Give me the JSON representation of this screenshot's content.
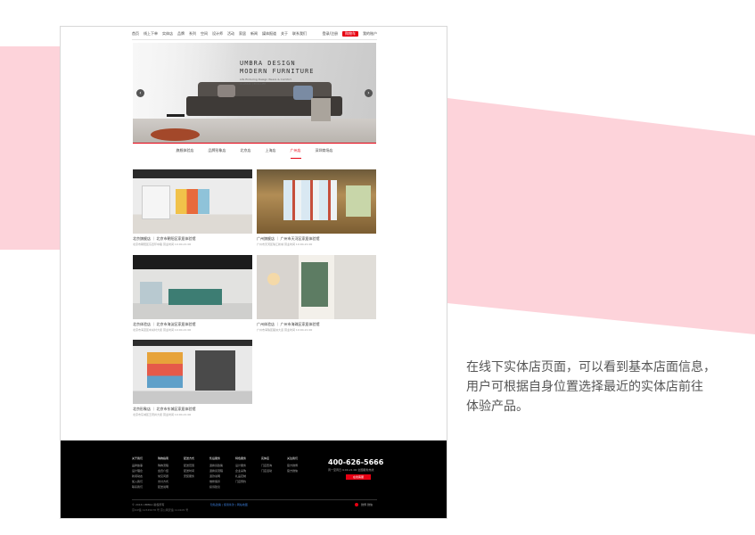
{
  "page": {
    "nav": {
      "items": [
        "首页",
        "线上下单",
        "实体店",
        "品牌",
        "系列",
        "空间",
        "设计师",
        "活动",
        "家居",
        "新闻",
        "媒体报道",
        "关于",
        "联系我们"
      ],
      "login": "登录/注册",
      "cart": "购物车",
      "account": "我的账户"
    },
    "hero": {
      "title_line1": "UMBRA DESIGN",
      "title_line2": "MODERN FURNITURE",
      "subtitle1": "Life Enduring Design Wears & Comfort",
      "subtitle2": "CLASSIC | ECO-LIFE"
    },
    "tabs": [
      {
        "label": "旗舰体验店",
        "active": false
      },
      {
        "label": "品牌形象店",
        "active": false
      },
      {
        "label": "北京店",
        "active": false
      },
      {
        "label": "上海店",
        "active": false
      },
      {
        "label": "广州店",
        "active": true
      },
      {
        "label": "深圳商场店",
        "active": false
      }
    ],
    "stores": [
      {
        "name": "北京旗舰店 ｜ 北京市朝阳区家居体验馆",
        "addr": "北京市朝阳区东四环中路 营业时间 10:00-21:00"
      },
      {
        "name": "广州旗舰店 ｜ 广州市天河区家居体验馆",
        "addr": "广州市天河区珠江新城 营业时间 10:00-21:00"
      },
      {
        "name": "北京体验店 ｜ 北京市海淀区家居体验馆",
        "addr": "北京市海淀区中关村大街 营业时间 10:00-21:00"
      },
      {
        "name": "广州体验店 ｜ 广州市海珠区家居体验馆",
        "addr": "广州市海珠区琶洲大道 营业时间 10:00-21:00"
      },
      {
        "name": "北京形象店 ｜ 北京市东城区家居体验馆",
        "addr": "北京市东城区王府井大街 营业时间 10:00-21:00"
      }
    ],
    "footer": {
      "columns": [
        {
          "title": "关于我们",
          "items": [
            "品牌故事",
            "设计理念",
            "新闻动态",
            "加入我们",
            "联系我们"
          ]
        },
        {
          "title": "购物指南",
          "items": [
            "购物流程",
            "会员介绍",
            "常见问题",
            "支付方式",
            "配送说明"
          ]
        },
        {
          "title": "配送方式",
          "items": [
            "配送范围",
            "配送时间",
            "安装服务"
          ]
        },
        {
          "title": "售后服务",
          "items": [
            "退换货政策",
            "退换货流程",
            "退款说明",
            "维修保养",
            "投诉建议"
          ]
        },
        {
          "title": "特色服务",
          "items": [
            "设计服务",
            "企业采购",
            "礼品定制",
            "门店预约"
          ]
        },
        {
          "title": "实体店",
          "items": [
            "门店查询",
            "门店活动"
          ]
        },
        {
          "title": "关注我们",
          "items": [
            "官方微博",
            "官方微信"
          ]
        }
      ],
      "phone": "400-626-5666",
      "hours": "周一至周日 9:00-21:00 全国服务热线",
      "button": "在线客服",
      "copyright": "© 2016 UMBRA 版权所有",
      "links": "隐私政策 | 使用条款 | 网站地图",
      "license": "京ICP备 12345678 号 京公网安备 110105 号",
      "icons_text": "微博 微信"
    }
  },
  "caption": {
    "line1": "在线下实体店页面，可以看到基本店面信息，",
    "line2": "用户可根据自身位置选择最近的实体店前往",
    "line3": "体验产品。"
  },
  "colors": {
    "accent": "#e60012",
    "band": "#fdd3da"
  }
}
